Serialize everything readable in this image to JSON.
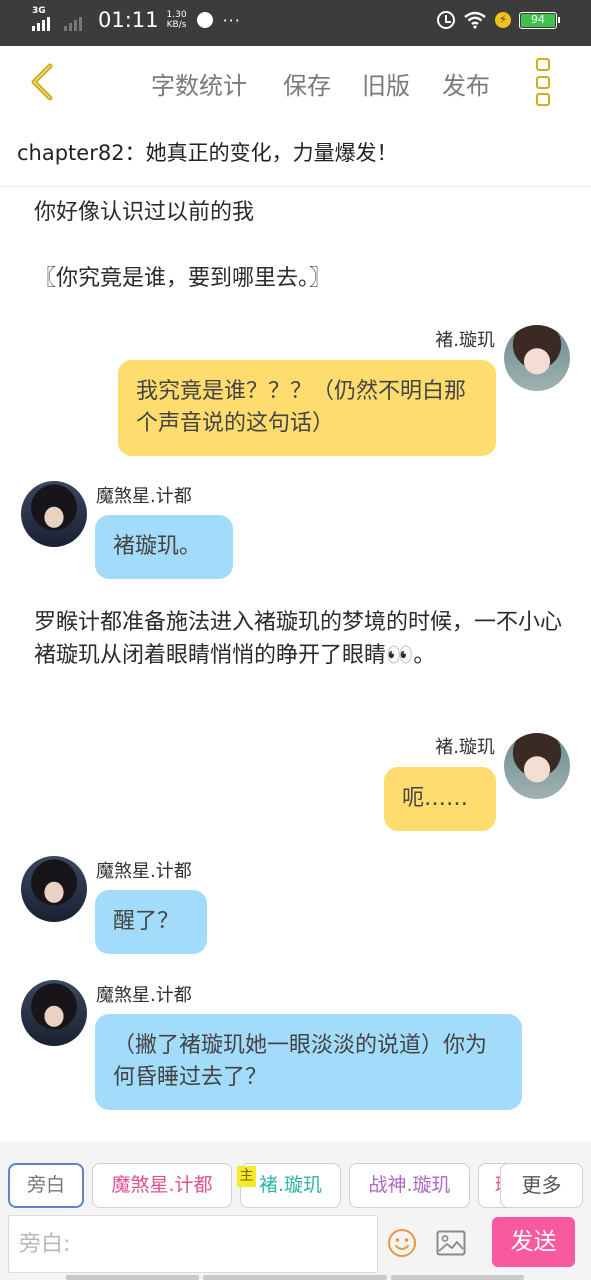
{
  "status_bar": {
    "network": "3G",
    "time": "01:11",
    "speed_value": "1.30",
    "speed_unit": "KB/s",
    "more": "···",
    "battery": "94"
  },
  "toolbar": {
    "word_count": "字数统计",
    "save": "保存",
    "old_version": "旧版",
    "publish": "发布"
  },
  "chapter_title": "chapter82：她真正的变化，力量爆发！",
  "messages": {
    "narration_1": "你好像认识过以前的我",
    "narration_2": "〖你究竟是谁，要到哪里去。〗",
    "msg_1_name": "褚.璇玑",
    "msg_1_text": "我究竟是谁？？？（仍然不明白那个声音说的这句话）",
    "msg_2_name": "魔煞星.计都",
    "msg_2_text": "褚璇玑。",
    "narration_3": "罗睺计都准备施法进入褚璇玑的梦境的时候，一不小心褚璇玑从闭着眼睛悄悄的睁开了眼睛👀。",
    "msg_3_name": "褚.璇玑",
    "msg_3_text": "呃……",
    "msg_4_name": "魔煞星.计都",
    "msg_4_text": "醒了？",
    "msg_5_name": "魔煞星.计都",
    "msg_5_text": "（撇了褚璇玑她一眼淡淡的说道）你为何昏睡过去了？"
  },
  "roles": {
    "narrator": "旁白",
    "role_1": "魔煞星.计都",
    "main_tag": "主",
    "role_2": "褚.璇玑",
    "role_3": "战神.璇玑",
    "role_4_partial": "璇",
    "more": "更多"
  },
  "composer": {
    "placeholder": "旁白:",
    "send": "发送"
  },
  "colors": {
    "accent_yellow": "#fedc6e",
    "accent_blue": "#a3dbfa",
    "send_pink": "#f9599e",
    "back_icon": "#d2ad1a"
  }
}
